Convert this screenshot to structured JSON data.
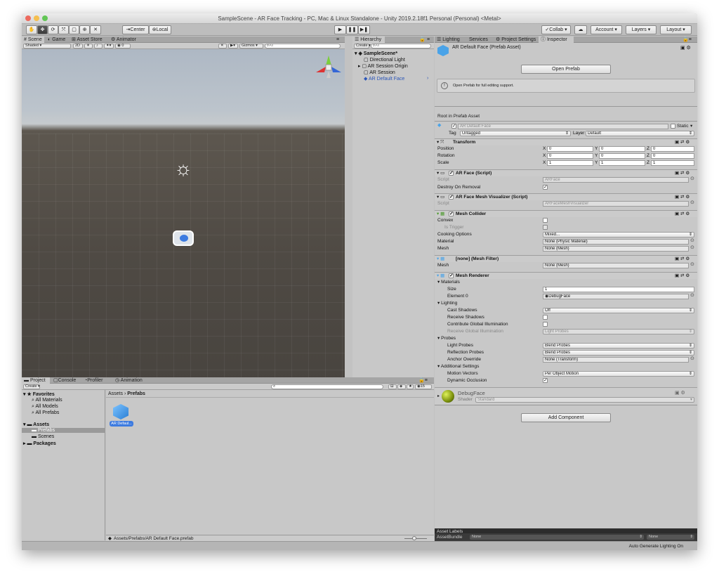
{
  "window": {
    "title": "SampleScene - AR Face Tracking - PC, Mac & Linux Standalone - Unity 2019.2.18f1 Personal (Personal) <Metal>"
  },
  "toolbar": {
    "center": "Center",
    "local": "Local",
    "collab": "Collab",
    "account": "Account",
    "layers": "Layers",
    "layout": "Layout"
  },
  "scene_tabs": [
    "Scene",
    "Game",
    "Asset Store",
    "Animator"
  ],
  "scene_bar": {
    "shaded": "Shaded",
    "mode_2d": "2D",
    "gizmos": "Gizmos",
    "search_placeholder": "All",
    "count": "0"
  },
  "hierarchy": {
    "tab": "Hierarchy",
    "create": "Create",
    "search_placeholder": "All",
    "scene": "SampleScene*",
    "items": [
      "Directional Light",
      "AR Session Origin",
      "AR Session",
      "AR Default Face"
    ]
  },
  "inspector_tabs": [
    "Lighting",
    "Services",
    "Project Settings",
    "Inspector"
  ],
  "inspector": {
    "asset_title": "AR Default Face (Prefab Asset)",
    "open_prefab": "Open Prefab",
    "help_text": "Open Prefab for full editing support.",
    "root_label": "Root in Prefab Asset",
    "object_name": "AR Default Face",
    "static_label": "Static",
    "tag_label": "Tag",
    "tag_value": "Untagged",
    "layer_label": "Layer",
    "layer_value": "Default",
    "transform": {
      "title": "Transform",
      "rows": [
        {
          "label": "Position",
          "x": "0",
          "y": "0",
          "z": "0"
        },
        {
          "label": "Rotation",
          "x": "0",
          "y": "0",
          "z": "0"
        },
        {
          "label": "Scale",
          "x": "1",
          "y": "1",
          "z": "1"
        }
      ]
    },
    "ar_face": {
      "title": "AR Face (Script)",
      "script_label": "Script",
      "script_value": "ARFace",
      "destroy_label": "Destroy On Removal"
    },
    "visualizer": {
      "title": "AR Face Mesh Visualizer (Script)",
      "script_label": "Script",
      "script_value": "ARFaceMeshVisualizer"
    },
    "collider": {
      "title": "Mesh Collider",
      "convex": "Convex",
      "is_trigger": "Is Trigger",
      "cooking": "Cooking Options",
      "cooking_value": "Mixed...",
      "material": "Material",
      "material_value": "None (Physic Material)",
      "mesh": "Mesh",
      "mesh_value": "None (Mesh)"
    },
    "mesh_filter": {
      "title": "[none] (Mesh Filter)",
      "mesh": "Mesh",
      "mesh_value": "None (Mesh)"
    },
    "renderer": {
      "title": "Mesh Renderer",
      "materials": "Materials",
      "size": "Size",
      "size_value": "1",
      "element0": "Element 0",
      "element0_value": "DebugFace",
      "lighting": "Lighting",
      "cast_shadows": "Cast Shadows",
      "cast_shadows_value": "Off",
      "receive_shadows": "Receive Shadows",
      "contribute_gi": "Contribute Global Illumination",
      "receive_gi": "Receive Global Illumination",
      "receive_gi_value": "Light Probes",
      "probes": "Probes",
      "light_probes": "Light Probes",
      "light_probes_value": "Blend Probes",
      "reflection_probes": "Reflection Probes",
      "reflection_probes_value": "Blend Probes",
      "anchor_override": "Anchor Override",
      "anchor_override_value": "None (Transform)",
      "additional": "Additional Settings",
      "motion_vectors": "Motion Vectors",
      "motion_vectors_value": "Per Object Motion",
      "dynamic_occlusion": "Dynamic Occlusion"
    },
    "material": {
      "name": "DebugFace",
      "shader_label": "Shader",
      "shader_value": "Standard"
    },
    "add_component": "Add Component",
    "asset_labels": "Asset Labels",
    "asset_bundle": "AssetBundle",
    "asset_bundle_value": "None",
    "asset_bundle_variant": "None"
  },
  "project": {
    "tabs": [
      "Project",
      "Console",
      "Profiler",
      "Animation"
    ],
    "create": "Create",
    "count": "15",
    "favorites": "Favorites",
    "fav_items": [
      "All Materials",
      "All Models",
      "All Prefabs"
    ],
    "assets": "Assets",
    "asset_items": [
      "Prefabs",
      "Scenes"
    ],
    "packages": "Packages",
    "breadcrumb_root": "Assets",
    "breadcrumb_sep": "›",
    "breadcrumb_leaf": "Prefabs",
    "item_label": "AR Defaul...",
    "path": "Assets/Prefabs/AR Default Face.prefab"
  },
  "status": {
    "text": "Auto Generate Lighting On"
  },
  "colors": {
    "selection": "#3d7be0",
    "scene_ground": "#504a44",
    "sky": "#b7c0c9"
  }
}
